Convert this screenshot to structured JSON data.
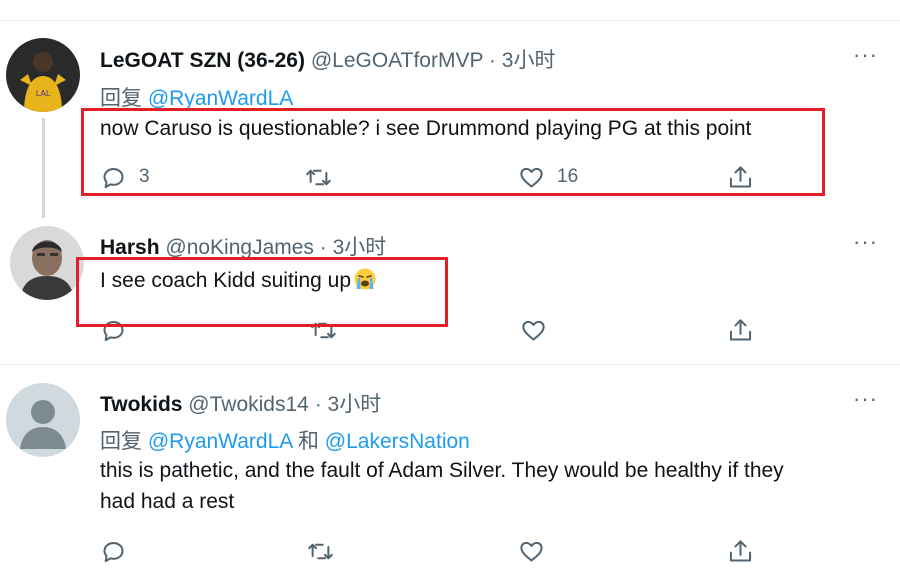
{
  "tweets": [
    {
      "name": "LeGOAT SZN (36-26)",
      "handle": "@LeGOATforMVP",
      "dot": "·",
      "time": "3小时",
      "reply_prefix": "回复",
      "reply_mention_1": "@RyanWardLA",
      "text": "now Caruso is questionable? i see Drummond playing PG at this point",
      "reply_count": "3",
      "like_count": "16"
    },
    {
      "name": "Harsh",
      "handle": "@noKingJames",
      "dot": "·",
      "time": "3小时",
      "text": "I see coach Kidd suiting up",
      "emoji": "loudly-crying-face"
    },
    {
      "name": "Twokids",
      "handle": "@Twokids14",
      "dot": "·",
      "time": "3小时",
      "reply_prefix": "回复",
      "reply_mention_1": "@RyanWardLA",
      "reply_and": "和",
      "reply_mention_2": "@LakersNation",
      "text_line_1": "this is pathetic, and the fault of Adam Silver. They would be healthy if they",
      "text_line_2": "had had a rest"
    }
  ],
  "more_label": "···",
  "icons": [
    "reply-icon",
    "retweet-icon",
    "like-icon",
    "share-icon",
    "more-icon"
  ],
  "colors": {
    "text": "#0f1419",
    "secondary": "#536471",
    "link": "#1d9bf0",
    "highlight_box": "#e21f26"
  }
}
